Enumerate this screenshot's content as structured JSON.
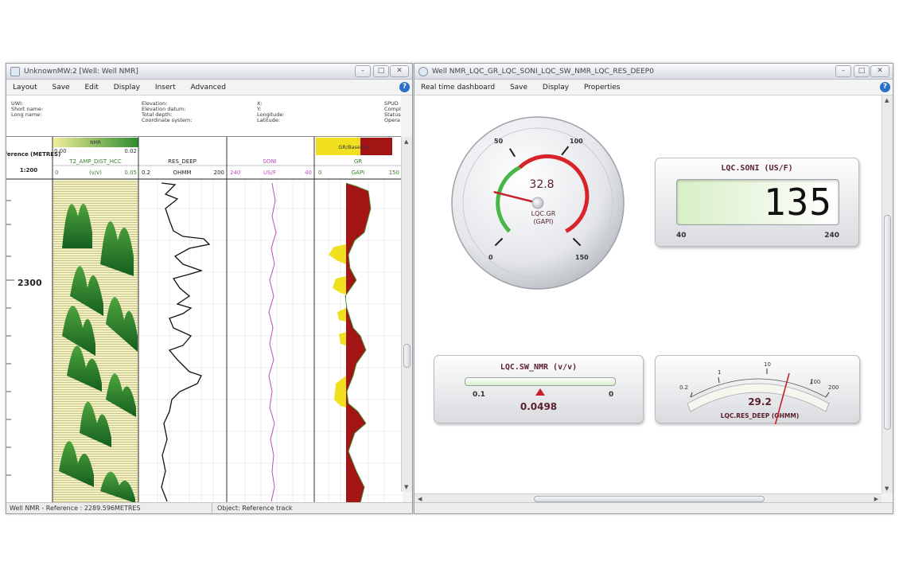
{
  "left_window": {
    "title": "UnknownMW:2 [Well: Well NMR]",
    "menu": [
      "Layout",
      "Save",
      "Edit",
      "Display",
      "Insert",
      "Advanced"
    ],
    "info_labels": {
      "col1": [
        "UWI:",
        "Short name:",
        "Long name:"
      ],
      "col2": [
        "Elevation:",
        "Elevation datum:",
        "Total depth:",
        "Coordinate system:"
      ],
      "col3": [
        "X:",
        "Y:",
        "Longitude:",
        "Latitude:"
      ],
      "col4": [
        "SPUD",
        "Compl",
        "Status",
        "Opera"
      ]
    },
    "reference_track": {
      "label": "Reference (METRES)",
      "scale": "1:200",
      "depth_label": "2300"
    },
    "tracks": [
      {
        "header_band": "NMR",
        "band_min": "0.00",
        "band_max": "0.02",
        "curve": "T2_AMP_DIST_HCC",
        "min": "0",
        "unit": "(v/v)",
        "max": "0.05"
      },
      {
        "curve": "RES_DEEP",
        "min": "0.2",
        "unit": "OHMM",
        "max": "200"
      },
      {
        "curve": "SONI",
        "min": "240",
        "unit": "US/F",
        "max": "40"
      },
      {
        "header_band": "GR/Baseline",
        "curve": "GR",
        "min": "0",
        "unit": "GAPI",
        "max": "150"
      }
    ],
    "status_left": "Well NMR - Reference : 2289.596METRES",
    "status_right": "Object: Reference track"
  },
  "right_window": {
    "title": "Well NMR_LQC_GR_LQC_SONI_LQC_SW_NMR_LQC_RES_DEEP0",
    "menu": [
      "Real time dashboard",
      "Save",
      "Display",
      "Properties"
    ],
    "gauge_gr": {
      "value": "32.8",
      "label_line1": "LQC.GR",
      "label_line2": "(GAPI)",
      "ticks": [
        "0",
        "50",
        "100",
        "150"
      ],
      "needle_value": 32.8,
      "min": 0,
      "max": 150
    },
    "digital_soni": {
      "title": "LQC.SONI (US/F)",
      "value": "135",
      "min": "40",
      "max": "240"
    },
    "linear_sw": {
      "title": "LQC.SW_NMR (v/v)",
      "min": "0.1",
      "max": "0",
      "value": "0.0498",
      "fraction": 0.502
    },
    "arc_res": {
      "ticks": [
        "0.2",
        "1",
        "10",
        "100",
        "200"
      ],
      "value": "29.2",
      "label": "LQC.RES_DEEP (OHMM)",
      "needle_value": 29.2
    }
  },
  "colors": {
    "nmr_dark": "#1f7a2a",
    "nmr_light": "#f2f0a8",
    "gr_fill": "#a31414",
    "gr_baseline": "#f0e020",
    "soni_curve": "#c04bc4",
    "gauge_red": "#d8232a",
    "gauge_green": "#49b648",
    "title_maroon": "#5a1f2e"
  }
}
